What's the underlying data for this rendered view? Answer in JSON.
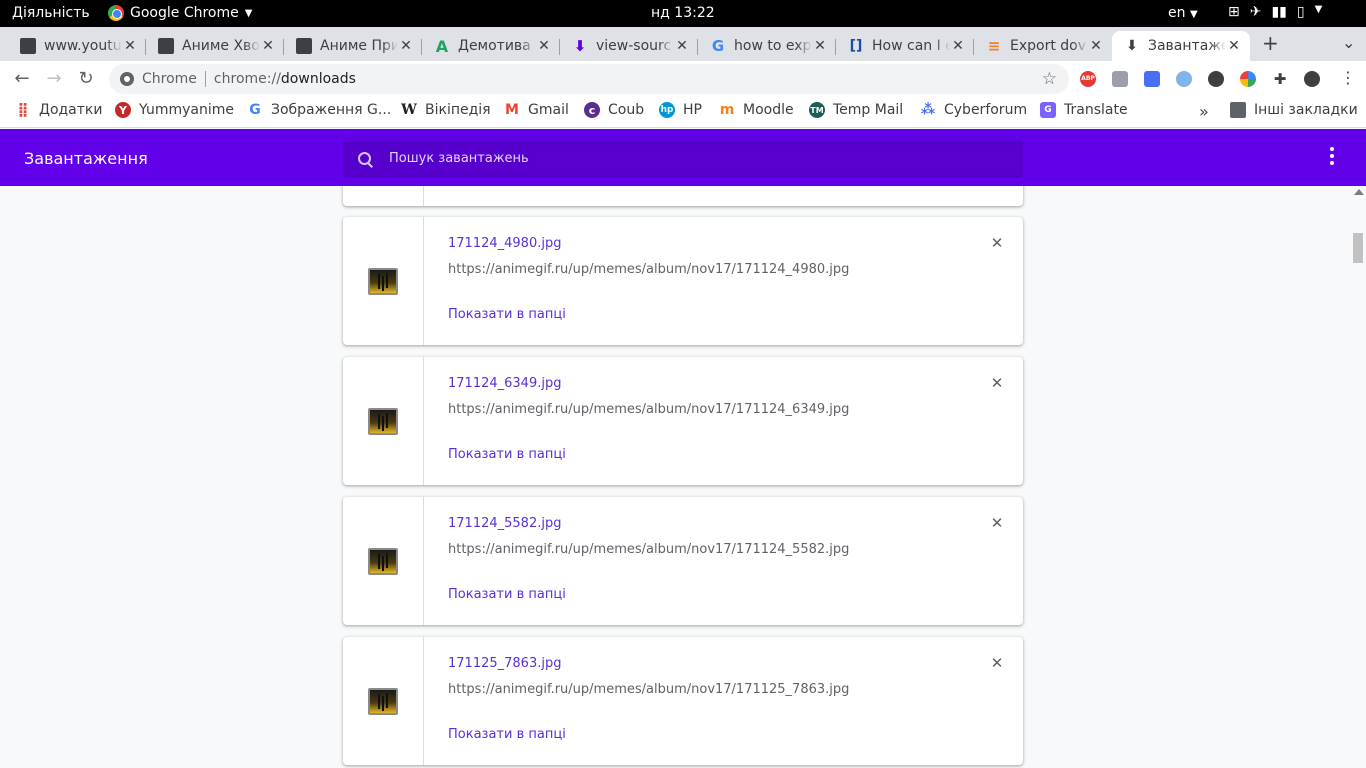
{
  "system": {
    "activities": "Діяльність",
    "app_name": "Google Chrome",
    "clock": "нд 13:22",
    "language": "en"
  },
  "tabs": [
    {
      "title": "www.youtu",
      "icon": "youtube-folder-icon"
    },
    {
      "title": "Аниме Хво",
      "icon": "folder-icon"
    },
    {
      "title": "Аниме При",
      "icon": "folder-icon"
    },
    {
      "title": "Демотива",
      "icon": "a-letter-icon"
    },
    {
      "title": "view-sourc",
      "icon": "download-icon"
    },
    {
      "title": "how to exp",
      "icon": "google-icon"
    },
    {
      "title": "How can I e",
      "icon": "document-icon"
    },
    {
      "title": "Export dov",
      "icon": "stackoverflow-icon"
    },
    {
      "title": "Завантаже",
      "icon": "download-icon"
    }
  ],
  "toolbar": {
    "site_label": "Chrome",
    "url_prefix": "chrome://",
    "url_host": "downloads"
  },
  "bookmarks": [
    {
      "label": "Додатки",
      "icon": "apps-grid-icon"
    },
    {
      "label": "Yummyanime",
      "icon": "yummyanime-icon"
    },
    {
      "label": "Зображення G...",
      "icon": "google-icon"
    },
    {
      "label": "Вікіпедія",
      "icon": "wikipedia-icon"
    },
    {
      "label": "Gmail",
      "icon": "gmail-icon"
    },
    {
      "label": "Coub",
      "icon": "coub-icon"
    },
    {
      "label": "HP",
      "icon": "hp-icon"
    },
    {
      "label": "Moodle",
      "icon": "moodle-icon"
    },
    {
      "label": "Temp Mail",
      "icon": "tempmail-icon"
    },
    {
      "label": "Cyberforum",
      "icon": "cyberforum-icon"
    },
    {
      "label": "Translate",
      "icon": "translate-icon"
    }
  ],
  "other_bookmarks": "Інші закладки",
  "downloads": {
    "title": "Завантаження",
    "search_placeholder": "Пошук завантажень",
    "items": [
      {
        "filename": "171124_4980.jpg",
        "url": "https://animegif.ru/up/memes/album/nov17/171124_4980.jpg",
        "action": "Показати в папці"
      },
      {
        "filename": "171124_6349.jpg",
        "url": "https://animegif.ru/up/memes/album/nov17/171124_6349.jpg",
        "action": "Показати в папці"
      },
      {
        "filename": "171124_5582.jpg",
        "url": "https://animegif.ru/up/memes/album/nov17/171124_5582.jpg",
        "action": "Показати в папці"
      },
      {
        "filename": "171125_7863.jpg",
        "url": "https://animegif.ru/up/memes/album/nov17/171125_7863.jpg",
        "action": "Показати в папці"
      }
    ]
  },
  "colors": {
    "accent": "#6200ea",
    "link": "#5b2fd4"
  }
}
